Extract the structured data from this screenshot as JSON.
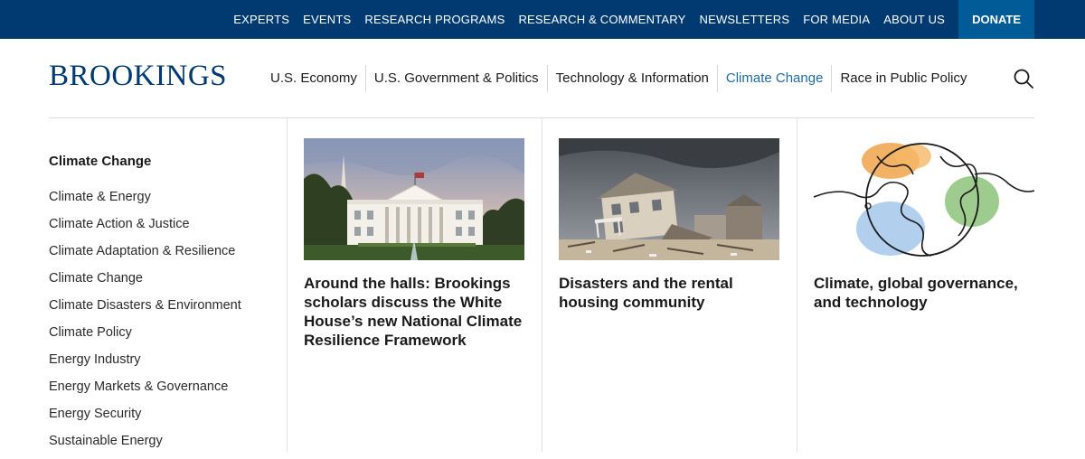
{
  "topnav": {
    "items": [
      "EXPERTS",
      "EVENTS",
      "RESEARCH PROGRAMS",
      "RESEARCH & COMMENTARY",
      "NEWSLETTERS",
      "FOR MEDIA",
      "ABOUT US"
    ],
    "donate": "DONATE"
  },
  "logo": "BROOKINGS",
  "mainnav": {
    "items": [
      "U.S. Economy",
      "U.S. Government & Politics",
      "Technology & Information",
      "Climate Change",
      "Race in Public Policy"
    ],
    "active": "Climate Change"
  },
  "submenu": {
    "title": "Climate Change",
    "items": [
      "Climate & Energy",
      "Climate Action & Justice",
      "Climate Adaptation & Resilience",
      "Climate Change",
      "Climate Disasters & Environment",
      "Climate Policy",
      "Energy Industry",
      "Energy Markets & Governance",
      "Energy Security",
      "Sustainable Energy"
    ]
  },
  "cards": [
    {
      "title": "Around the halls: Brookings scholars discuss the White House’s new National Climate Resilience Framework",
      "image": "white-house-photo"
    },
    {
      "title": "Disasters and the rental housing community",
      "image": "damaged-house-photo"
    },
    {
      "title": "Climate, global governance, and technology",
      "image": "globe-line-illustration"
    }
  ],
  "colors": {
    "topbar": "#003a70",
    "donate": "#005b96",
    "active_link": "#1e6aa1",
    "logo": "#003a70"
  }
}
